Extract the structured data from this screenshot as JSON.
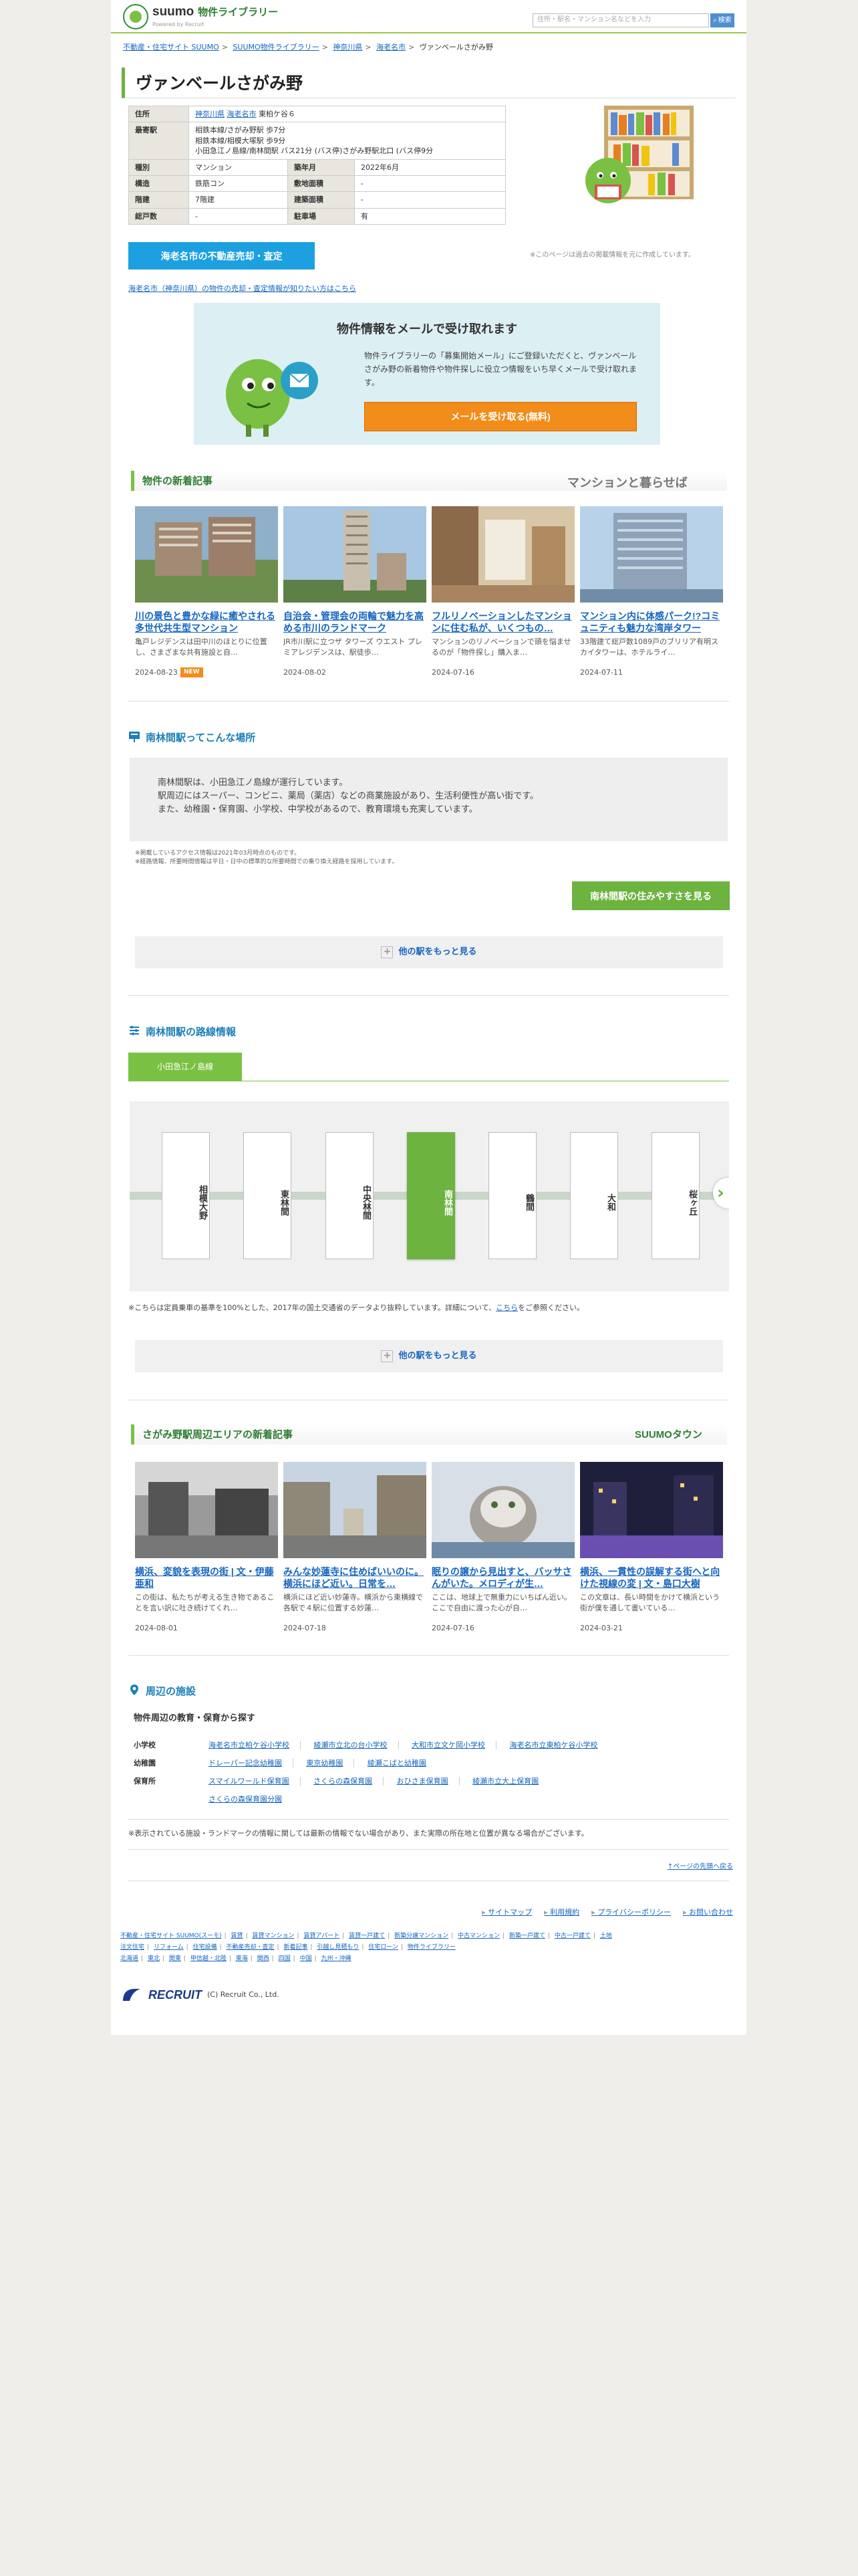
{
  "header": {
    "logo_main": "suumo",
    "logo_sub": "物件ライブラリー",
    "logo_small": "Powered by Recruit",
    "search_placeholder": "住所・駅名・マンション名などを入力",
    "search_button": "検索"
  },
  "breadcrumb": [
    "不動産・住宅サイト SUUMO",
    "SUUMO物件ライブラリー",
    "神奈川県",
    "海老名市",
    "ヴァンベールさがみ野"
  ],
  "page_title": "ヴァンベールさがみ野",
  "property": {
    "address_label": "住所",
    "address_links": [
      "神奈川県",
      "海老名市"
    ],
    "address_rest": "東柏ケ谷６",
    "station_label": "最寄駅",
    "stations": [
      "相鉄本線/さがみ野駅 歩7分",
      "相鉄本線/相模大塚駅 歩9分",
      "小田急江ノ島線/南林間駅 バス21分 (バス停)さがみ野駅北口 (バス停9分"
    ],
    "rows": [
      {
        "k1": "種別",
        "v1": "マンション",
        "k2": "築年月",
        "v2": "2022年6月"
      },
      {
        "k1": "構造",
        "v1": "鉄筋コン",
        "k2": "敷地面積",
        "v2": "-"
      },
      {
        "k1": "階建",
        "v1": "7階建",
        "k2": "建築面積",
        "v2": "-"
      },
      {
        "k1": "総戸数",
        "v1": "-",
        "k2": "駐車場",
        "v2": "有"
      }
    ],
    "sale_button": "海老名市の不動産売却・査定",
    "note_right": "※このページは過去の掲載情報を元に作成しています。",
    "sale_link": "海老名市（神奈川県）の物件の売却・査定情報が知りたい方はこちら"
  },
  "mail": {
    "title": "物件情報をメールで受け取れます",
    "text": "物件ライブラリーの「募集開始メール」にご登録いただくと、ヴァンベールさがみ野の新着物件や物件探しに役立つ情報をいち早くメールで受け取れます。",
    "button": "メールを受け取る(無料)"
  },
  "articles": {
    "heading": "物件の新着記事",
    "brand": "マンションと暮らせば",
    "items": [
      {
        "title": "川の景色と豊かな緑に癒やされる多世代共生型マンション",
        "desc": "亀戸レジデンスは田中川のほとりに位置し、さまざまな共有施設と自…",
        "date": "2024-08-23",
        "badge": "NEW"
      },
      {
        "title": "自治会・管理会の両輪で魅力を高める市川のランドマーク",
        "desc": "JR市川駅に立つザ タワーズ ウエスト プレミアレジデンスは、駅徒歩…",
        "date": "2024-08-02",
        "badge": ""
      },
      {
        "title": "フルリノベーションしたマンションに住む私が、いくつもの…",
        "desc": "マンションのリノベーションで頭を悩ませるのが「物件探し」購入ま…",
        "date": "2024-07-16",
        "badge": ""
      },
      {
        "title": "マンション内に体感パーク!?コミュニティも魅力な湾岸タワー",
        "desc": "33階建て総戸数1089戸のブリリア有明スカイタワーは、ホテルライ…",
        "date": "2024-07-11",
        "badge": ""
      }
    ]
  },
  "station": {
    "heading": "南林間駅ってこんな場所",
    "lines": [
      "南林間駅は、小田急江ノ島線が運行しています。",
      "駅周辺にはスーパー、コンビニ、薬局（薬店）などの商業施設があり、生活利便性が高い街です。",
      "また、幼稚園・保育園、小学校、中学校があるので、教育環境も充実しています。"
    ],
    "notes": [
      "※掲載しているアクセス情報は2021年03月時点のものです。",
      "※経路情報、所要時間情報は平日・日中の標準的な所要時間での乗り換え経路を採用しています。"
    ],
    "button": "南林間駅の住みやすさを見る",
    "more": "他の駅をもっと見る"
  },
  "route": {
    "heading": "南林間駅の路線情報",
    "tab": "小田急江ノ島線",
    "stations": [
      "相模大野",
      "東林間",
      "中央林間",
      "南林間",
      "鶴間",
      "大和",
      "桜ヶ丘"
    ],
    "current": "南林間",
    "note_prefix": "※こちらは定員乗車の基準を100%とした、2017年の国土交通省のデータより抜粋しています。詳細について、",
    "note_link": "こちら",
    "note_suffix": "をご参照ください。",
    "more": "他の駅をもっと見る"
  },
  "area_articles": {
    "heading": "さがみ野駅周辺エリアの新着記事",
    "brand": "SUUMOタウン",
    "items": [
      {
        "title": "横浜、変貌を表現の街 | 文・伊藤亜和",
        "desc": "この街は、私たちが考える生き物であることを言い訳に吐き続けてくれ…",
        "date": "2024-08-01"
      },
      {
        "title": "みんな妙蓮寺に住めばいいのに。横浜にほど近い。日常を…",
        "desc": "横浜にほど近い妙蓮寺。横浜から東横線で各駅で４駅に位置する妙蓮…",
        "date": "2024-07-18"
      },
      {
        "title": "眠りの譲から見出すと、バッサさんがいた。メロディが生…",
        "desc": "ここは、地球上で無重力にいちばん近い。ここで自由に渡った心が自…",
        "date": "2024-07-16"
      },
      {
        "title": "横浜、一貫性の誤解する街へと向けた視線の変 | 文・島口大樹",
        "desc": "この文章は、長い時間をかけて横浜という街が僕を通して書いている…",
        "date": "2024-03-21"
      }
    ]
  },
  "facilities": {
    "heading": "周辺の施設",
    "sub": "物件周辺の教育・保育から探す",
    "rows": [
      {
        "k": "小学校",
        "items": [
          "海老名市立柏ケ谷小学校",
          "綾瀬市立北の台小学校",
          "大和市立文ケ岡小学校",
          "海老名市立東柏ケ谷小学校"
        ]
      },
      {
        "k": "幼稚園",
        "items": [
          "ドレーパー記念幼稚園",
          "東京幼稚園",
          "綾瀬こばと幼稚園"
        ]
      },
      {
        "k": "保育所",
        "items": [
          "スマイルワールド保育園",
          "さくらの森保育園",
          "おひさま保育園",
          "綾瀬市立大上保育園"
        ]
      },
      {
        "k": "",
        "items": [
          "さくらの森保育園分園"
        ]
      }
    ],
    "note": "※表示されている施設・ランドマークの情報に関しては最新の情報でない場合があり、また実際の所在地と位置が異なる場合がございます。"
  },
  "footer": {
    "pagetop": "↑ページの先頭へ戻る",
    "links": [
      "サイトマップ",
      "利用規約",
      "プライバシーポリシー",
      "お問い合わせ"
    ],
    "line1": [
      "不動産・住宅サイト SUUMO(スーモ)",
      "賃貸",
      "賃貸マンション",
      "賃貸アパート",
      "賃貸一戸建て",
      "新築分譲マンション",
      "中古マンション",
      "新築一戸建て",
      "中古一戸建て",
      "土地"
    ],
    "line2": [
      "注文住宅",
      "リフォーム",
      "住宅設備",
      "不動産売却・査定",
      "新着記事",
      "引越し見積もり",
      "住宅ローン",
      "物件ライブラリー"
    ],
    "line3": [
      "北海道",
      "東北",
      "関東",
      "甲信越・北陸",
      "東海",
      "関西",
      "四国",
      "中国",
      "九州・沖縄"
    ],
    "company": "RECRUIT",
    "copyright": "(C) Recruit Co., Ltd."
  }
}
